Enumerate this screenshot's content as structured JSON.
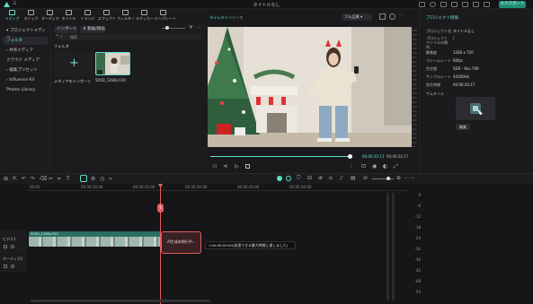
{
  "window": {
    "title": "タイトルなし",
    "export_label": "エクスポート"
  },
  "toolbar": [
    {
      "label": "メディア",
      "icon": "media-icon",
      "active": true
    },
    {
      "label": "ストック",
      "icon": "stock-icon"
    },
    {
      "label": "オーディオ",
      "icon": "music-icon"
    },
    {
      "label": "タイトル",
      "icon": "text-icon"
    },
    {
      "label": "トランジ",
      "icon": "transition-icon"
    },
    {
      "label": "エフェクト",
      "icon": "effects-icon"
    },
    {
      "label": "フィルター",
      "icon": "filter-icon"
    },
    {
      "label": "ステッカー",
      "icon": "sticker-icon"
    },
    {
      "label": "テンプレート",
      "icon": "template-icon"
    }
  ],
  "leftnav": {
    "items": [
      {
        "label": "プロジェクトメディア"
      },
      {
        "label": "フォルダ"
      },
      {
        "label": "共有メディア"
      },
      {
        "label": "クラウド メディア"
      },
      {
        "label": "編集プリセット"
      },
      {
        "label": "Influence Kit"
      },
      {
        "label": "Photos Library"
      }
    ]
  },
  "media": {
    "import_label": "インポート",
    "ai_label": "動画/録画",
    "search_placeholder": "検索",
    "folder_label": "フォルダ",
    "import_card_label": "メディアをインポート",
    "clip_label": "5050_1280x720"
  },
  "player": {
    "tab_timeline": "タイムライン",
    "tab_source": "ソース",
    "quality": "フル品質",
    "current_time": "00:00:20:17",
    "total_time": "00:00:20:17"
  },
  "props": {
    "header": "プロジェクト情報",
    "rows": [
      {
        "k": "プロジェクト名",
        "v": "タイトルなし"
      },
      {
        "k": "プロジェクトファイルの場所",
        "v": "/"
      },
      {
        "k": "解像度",
        "v": "1280 x 720"
      },
      {
        "k": "フレームレート",
        "v": "60fps"
      },
      {
        "k": "色空間",
        "v": "SDR - Rec.709"
      },
      {
        "k": "サンプルレート",
        "v": "44100Hz"
      },
      {
        "k": "再生時間",
        "v": "00:00:20:17"
      },
      {
        "k": "サムネイル",
        "v": ""
      }
    ],
    "edit_label": "編集"
  },
  "timeline": {
    "ruler": [
      "00:00",
      "00:00:10:00",
      "00:00:20:00",
      "00:00:30:00",
      "00:00:40:00",
      "00:00:50:00"
    ],
    "video_track": "ビデオ1",
    "audio_track": "オーディオ1",
    "clip_name": "5050_1280x720",
    "ai_clip_label": "AI生成本例行中...",
    "tooltip": "+00:00:00:00(拡張できる最大時間に達しました)",
    "playhead_label": "Ⅱ",
    "zoom_label": "ー・ー",
    "meter_db": [
      "0",
      "-6",
      "-12",
      "-18",
      "-24",
      "-30",
      "-36",
      "-42",
      "-48",
      "-54"
    ]
  },
  "colors": {
    "accent": "#5fe0c3",
    "playhead": "#e85a5a",
    "clip": "#2a6f66"
  }
}
